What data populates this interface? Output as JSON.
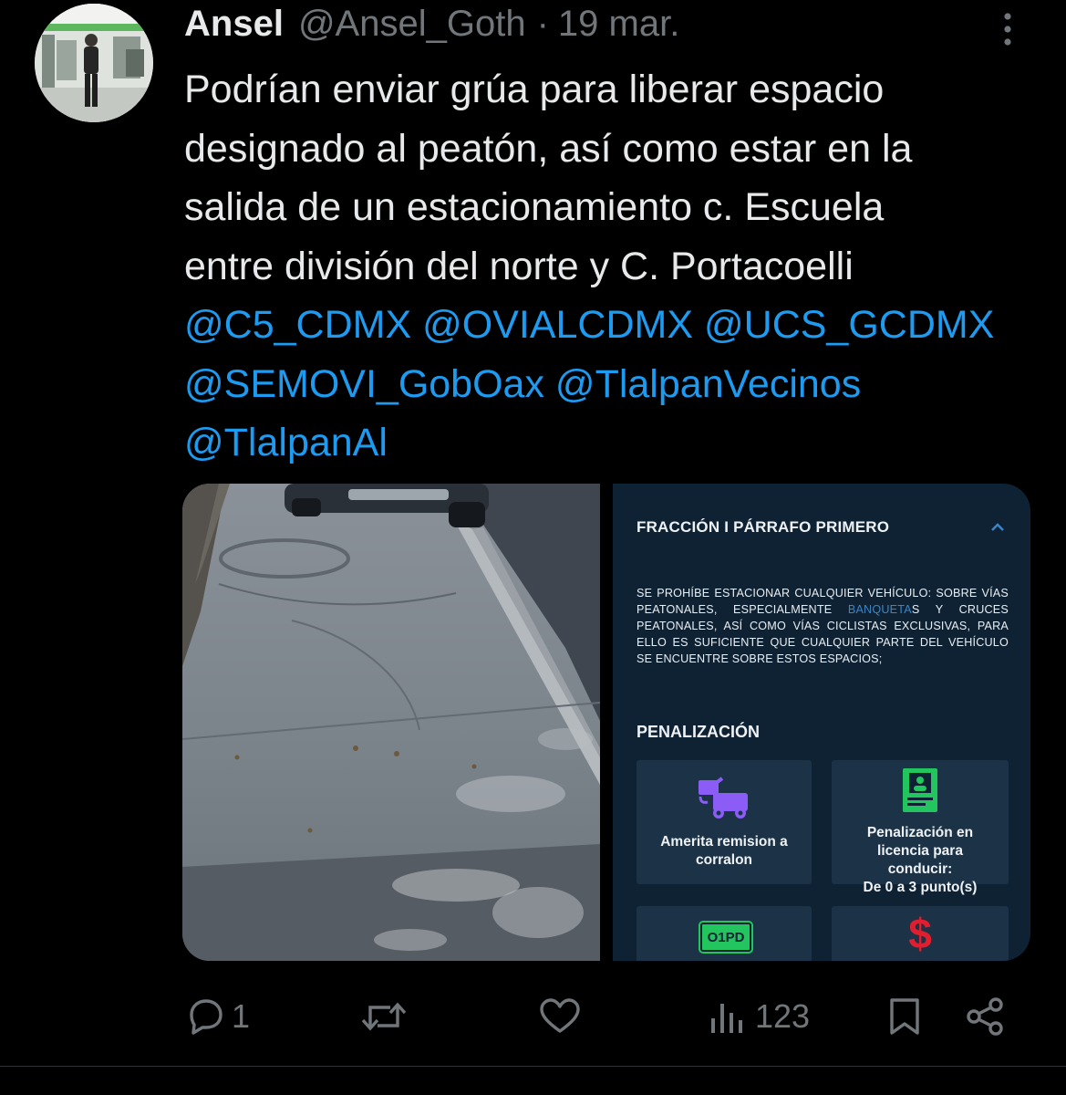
{
  "tweet": {
    "author_name": "Ansel",
    "author_handle": "@Ansel_Goth",
    "separator": "·",
    "date": "19 mar.",
    "text_lines": [
      "Podrían enviar grúa para liberar espacio",
      "designado al peatón, así como estar en la",
      "salida de un estacionamiento c. Escuela",
      "entre división del norte y C. Portacoelli"
    ],
    "mentions_lines": [
      [
        "@C5_CDMX",
        "@OVIALCDMX",
        "@UCS_GCDMX"
      ],
      [
        "@SEMOVI_GobOax",
        "@TlalpanVecinos"
      ],
      [
        "@TlalpanAl"
      ]
    ]
  },
  "media": {
    "screenshot": {
      "section_title": "FRACCIÓN I PÁRRAFO PRIMERO",
      "rule_before_link": "SE PROHÍBE ESTACIONAR CUALQUIER VEHÍCULO: SOBRE VÍAS PEATONALES, ESPECIALMENTE ",
      "rule_link": "BANQUETA",
      "rule_after_link": "S Y CRUCES PEATONALES, ASÍ COMO VÍAS CICLISTAS EXCLUSIVAS, PARA ELLO ES SUFICIENTE QUE CUALQUIER PARTE DEL VEHÍCULO SE ENCUENTRE SOBRE ESTOS ESPACIOS;",
      "penalty_title": "PENALIZACIÓN",
      "card_tow_label": "Amerita remision a corralon",
      "card_license_label_1": "Penalización en",
      "card_license_label_2": "licencia para",
      "card_license_label_3": "conducir:",
      "card_license_label_4": "De 0 a 3 punto(s)",
      "card_plate_text": "O1PD",
      "card_fine_symbol": "$"
    }
  },
  "actions": {
    "reply_count": "1",
    "retweet_count": "",
    "like_count": "",
    "views_count": "123"
  },
  "colors": {
    "background": "#000000",
    "text": "#e7e9ea",
    "secondary": "#71767b",
    "link": "#1d9bf0",
    "app_bg": "#0f2233",
    "card_bg": "#1b3247"
  }
}
